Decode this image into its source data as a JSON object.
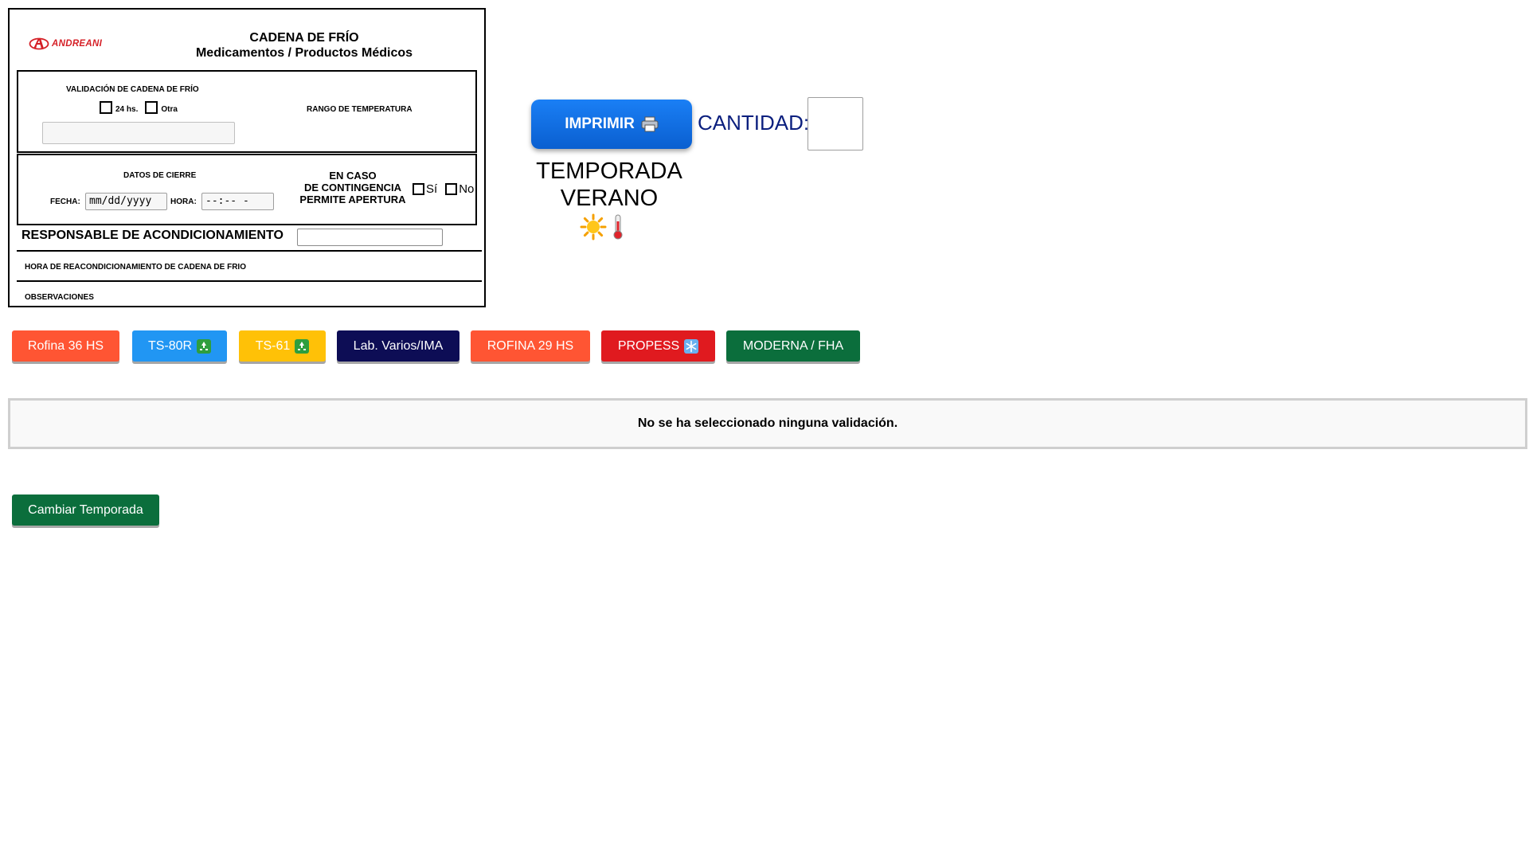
{
  "header": {
    "logo_text": "ANDREANI",
    "title_line1": "CADENA DE FRÍO",
    "title_line2": "Medicamentos / Productos Médicos"
  },
  "validation": {
    "label": "VALIDACIÓN DE CADENA DE FRÍO",
    "option_24": "24 hs.",
    "option_otra": "Otra",
    "input_value": "",
    "range_label": "RANGO DE TEMPERATURA"
  },
  "closing": {
    "label": "DATOS DE CIERRE",
    "fecha_label": "FECHA:",
    "fecha_placeholder": "mm/dd/yyyy",
    "hora_label": "HORA:",
    "hora_placeholder": "--:-- -",
    "contingency_line1": "EN CASO",
    "contingency_line2": "DE CONTINGENCIA",
    "contingency_line3": "PERMITE APERTURA",
    "opt_si": "Sí",
    "opt_no": "No"
  },
  "responsable": {
    "label": "RESPONSABLE DE ACONDICIONAMIENTO",
    "value": ""
  },
  "reacond_label": "HORA DE REACONDICIONAMIENTO DE CADENA DE FRIO",
  "observaciones_label": "OBSERVACIONES",
  "print": {
    "button_label": "IMPRIMIR",
    "quantity_label": "CANTIDAD:",
    "quantity_value": ""
  },
  "season": {
    "line1": "TEMPORADA",
    "line2": "VERANO",
    "icons": [
      "sun-icon",
      "thermometer-icon"
    ]
  },
  "validation_buttons": [
    {
      "label": "Rofina 36 HS",
      "color": "#ff5533",
      "icon": ""
    },
    {
      "label": "TS-80R",
      "color": "#2196f3",
      "icon": "recycle-icon"
    },
    {
      "label": "TS-61",
      "color": "#ffc107",
      "icon": "recycle-icon"
    },
    {
      "label": "Lab. Varios/IMA",
      "color": "#0d0d55",
      "icon": ""
    },
    {
      "label": "ROFINA 29 HS",
      "color": "#ff5533",
      "icon": ""
    },
    {
      "label": "PROPESS",
      "color": "#e01a1f",
      "icon": "snowflake-icon"
    },
    {
      "label": "MODERNA / FHA",
      "color": "#0b6e3c",
      "icon": ""
    }
  ],
  "message": "No se ha seleccionado ninguna validación.",
  "season_button_label": "Cambiar Temporada"
}
